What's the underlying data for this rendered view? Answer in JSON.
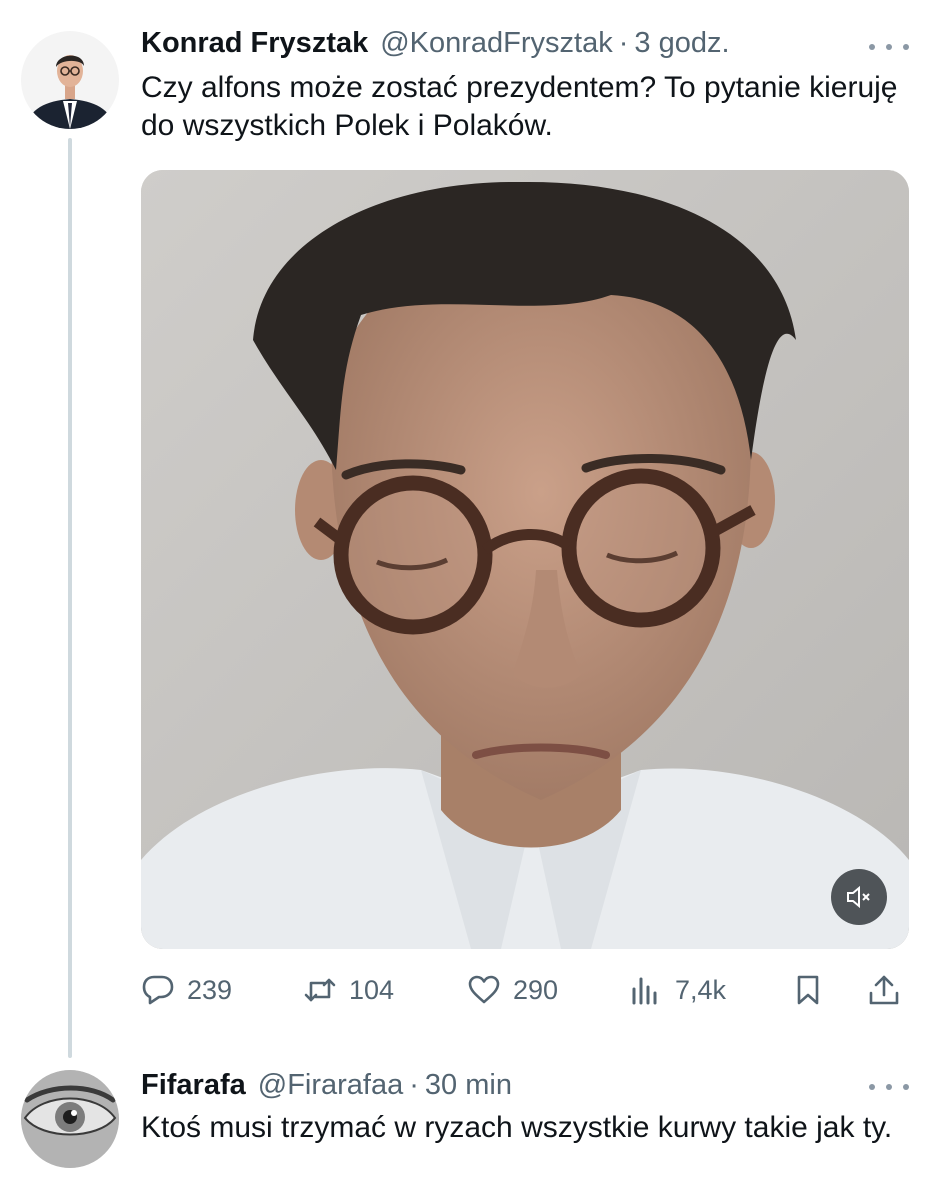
{
  "thread": {
    "tweets": [
      {
        "author_name": "Konrad Frysztak",
        "handle": "@KonradFrysztak",
        "separator": "·",
        "time": "3 godz.",
        "text": "Czy alfons może zostać prezydentem? To pytanie kieruję do wszystkich Polek i Polaków.",
        "avatar_icon": "man-in-suit-avatar",
        "media": {
          "type": "video",
          "muted_icon": "volume-mute-icon"
        },
        "actions": {
          "replies": "239",
          "retweets": "104",
          "likes": "290",
          "views": "7,4k"
        }
      },
      {
        "author_name": "Fifarafa",
        "handle": "@Firarafaa",
        "separator": "·",
        "time": "30 min",
        "text": "Ktoś musi trzymać w ryzach wszystkie kurwy takie jak ty.",
        "avatar_icon": "eye-avatar"
      }
    ]
  },
  "icons": {
    "reply": "reply-icon",
    "retweet": "retweet-icon",
    "like": "heart-icon",
    "views": "views-icon",
    "bookmark": "bookmark-icon",
    "share": "share-icon",
    "more": "more-icon"
  },
  "colors": {
    "text": "#0f1419",
    "secondary": "#536471",
    "thread_line": "#cfd9de",
    "background": "#ffffff"
  }
}
